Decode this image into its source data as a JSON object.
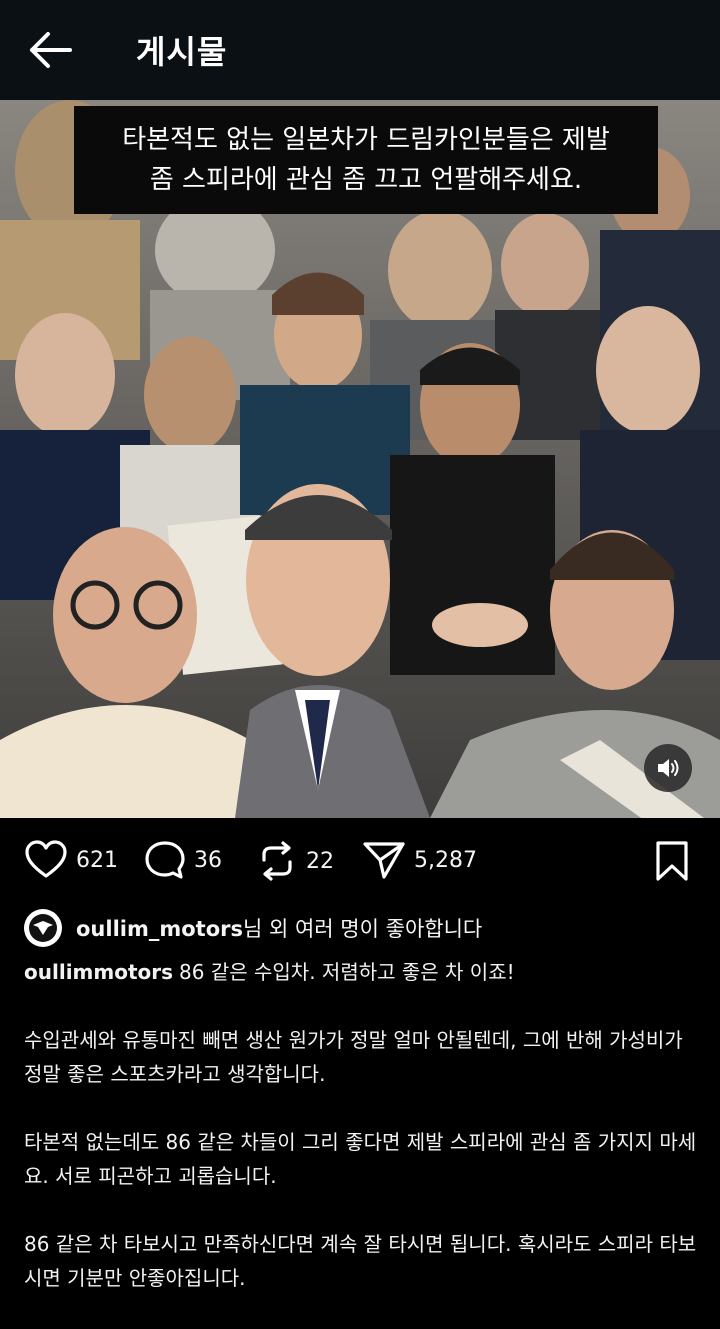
{
  "header": {
    "title": "게시물"
  },
  "media": {
    "caption_line1": "타본적도 없는 일본차가 드림카인분들은 제발",
    "caption_line2": "좀 스피라에 관심 좀 끄고 언팔해주세요."
  },
  "actions": {
    "likes": "621",
    "comments": "36",
    "reposts": "22",
    "shares": "5,287"
  },
  "liked_by": {
    "username": "oullim_motors",
    "suffix": "님 외 여러 명이 좋아합니다"
  },
  "post": {
    "author": "oullimmotors",
    "line1": "86 같은 수입차. 저렴하고 좋은 차 이죠!",
    "para2": "수입관세와 유통마진 빼면 생산 원가가 정말 얼마 안될텐데, 그에 반해 가성비가 정말 좋은 스포츠카라고 생각합니다.",
    "para3": "타본적 없는데도 86 같은 차들이 그리 좋다면 제발 스피라에 관심 좀 가지지 마세요. 서로 피곤하고 괴롭습니다.",
    "para4": "86 같은 차 타보시고 만족하신다면 계속 잘 타시면 됩니다. 혹시라도 스피라 타보시면 기분만 안좋아집니다."
  },
  "icons": {
    "back": "arrow-left-icon",
    "like": "heart-icon",
    "comment": "speech-bubble-icon",
    "repost": "repost-icon",
    "share": "send-icon",
    "save": "bookmark-icon",
    "sound": "speaker-icon"
  }
}
